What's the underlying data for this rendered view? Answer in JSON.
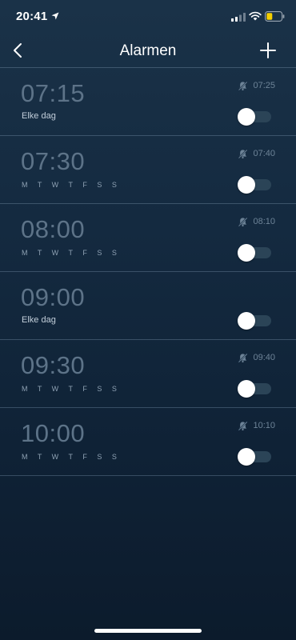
{
  "status_bar": {
    "time": "20:41",
    "icons": [
      "location-arrow-icon",
      "cellular-signal-icon",
      "wifi-icon",
      "battery-low-icon"
    ],
    "battery_color": "#f5d000"
  },
  "header": {
    "title": "Alarmen",
    "back_icon": "chevron-left-icon",
    "add_icon": "plus-icon"
  },
  "colors": {
    "background": "#142a40",
    "alarm_time_text": "#5d7388",
    "separator": "#4a6478",
    "toggle_track": "#2b4457",
    "toggle_knob": "#ffffff"
  },
  "alarms": [
    {
      "time": "07:15",
      "repeat": "Elke dag",
      "days": "",
      "snooze_icon": "snooze-bell-icon",
      "snooze_time": "07:25",
      "enabled": false
    },
    {
      "time": "07:30",
      "repeat": "",
      "days": "M T W T F S S",
      "snooze_icon": "snooze-bell-icon",
      "snooze_time": "07:40",
      "enabled": false
    },
    {
      "time": "08:00",
      "repeat": "",
      "days": "M T W T F S S",
      "snooze_icon": "snooze-bell-icon",
      "snooze_time": "08:10",
      "enabled": false
    },
    {
      "time": "09:00",
      "repeat": "Elke dag",
      "days": "",
      "snooze_icon": "",
      "snooze_time": "",
      "enabled": false
    },
    {
      "time": "09:30",
      "repeat": "",
      "days": "M T W T F S S",
      "snooze_icon": "snooze-bell-icon",
      "snooze_time": "09:40",
      "enabled": false
    },
    {
      "time": "10:00",
      "repeat": "",
      "days": "M T W T F S S",
      "snooze_icon": "snooze-bell-icon",
      "snooze_time": "10:10",
      "enabled": false
    }
  ]
}
